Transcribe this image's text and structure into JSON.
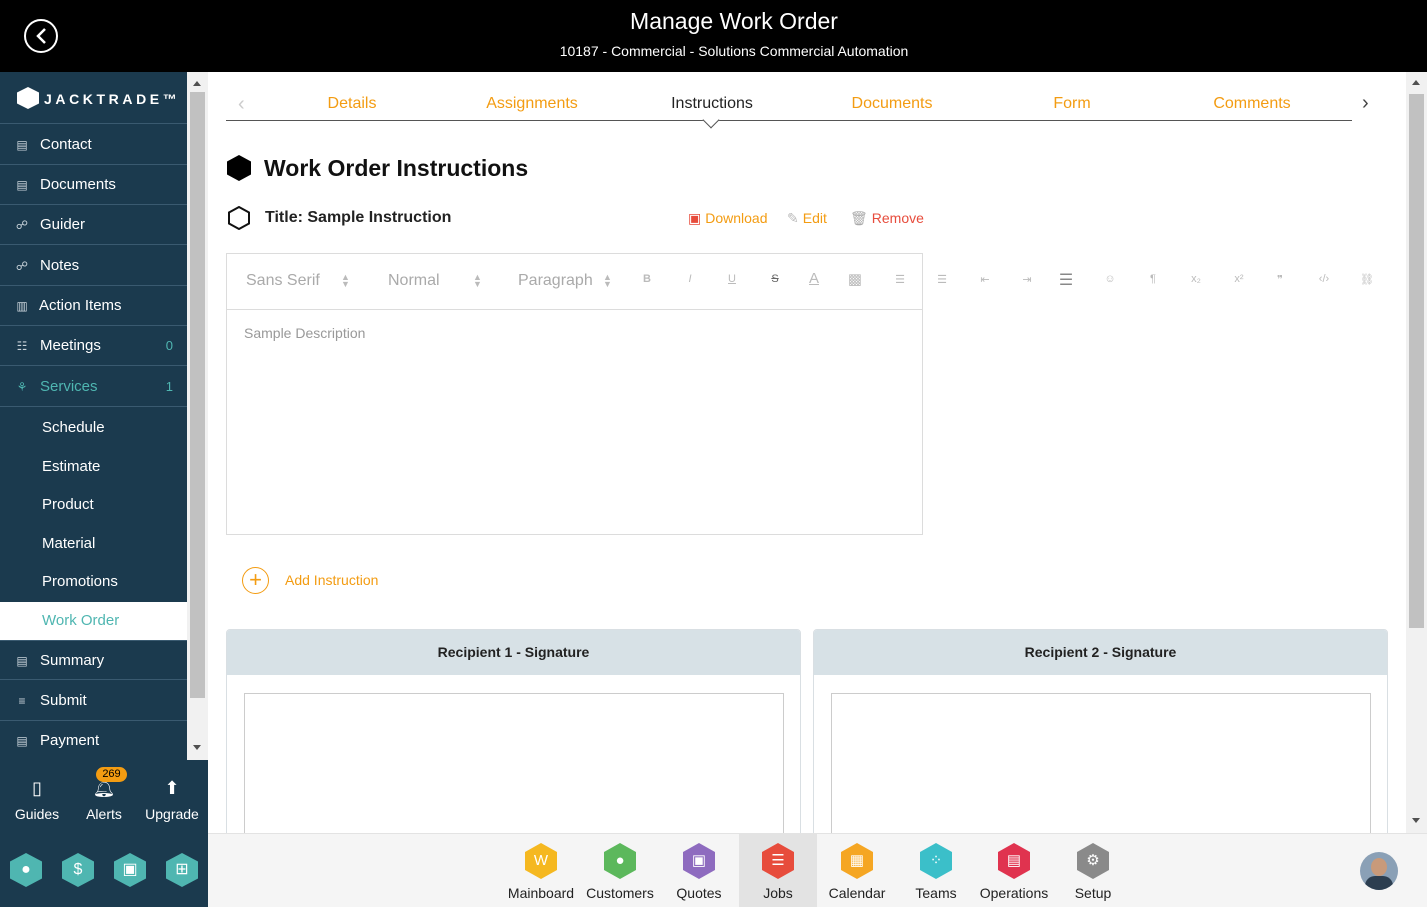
{
  "header": {
    "title": "Manage Work Order",
    "subtitle": "10187 - Commercial - Solutions Commercial Automation"
  },
  "brand": {
    "name": "JACKTRADE™"
  },
  "sidebar": {
    "items": [
      {
        "label": "Contact",
        "icon": "contact-card-icon"
      },
      {
        "label": "Documents",
        "icon": "documents-icon"
      },
      {
        "label": "Guider",
        "icon": "guider-icon"
      },
      {
        "label": "Notes",
        "icon": "notes-icon"
      },
      {
        "label": "Action Items",
        "icon": "clipboard-icon"
      },
      {
        "label": "Meetings",
        "icon": "meetings-icon",
        "count": "0"
      },
      {
        "label": "Services",
        "icon": "services-icon",
        "count": "1"
      }
    ],
    "sub_items": [
      {
        "label": "Schedule"
      },
      {
        "label": "Estimate"
      },
      {
        "label": "Product"
      },
      {
        "label": "Material"
      },
      {
        "label": "Promotions"
      },
      {
        "label": "Work Order"
      }
    ],
    "items_after": [
      {
        "label": "Summary",
        "icon": "summary-icon"
      },
      {
        "label": "Submit",
        "icon": "submit-icon"
      },
      {
        "label": "Payment",
        "icon": "payment-icon"
      }
    ],
    "bottom": {
      "guides": "Guides",
      "alerts": "Alerts",
      "alerts_count": "269",
      "upgrade": "Upgrade"
    }
  },
  "tabs": {
    "items": [
      "Details",
      "Assignments",
      "Instructions",
      "Documents",
      "Form",
      "Comments"
    ],
    "active": "Instructions"
  },
  "section": {
    "title": "Work Order Instructions",
    "instruction_title": "Title: Sample Instruction",
    "download": "Download",
    "edit": "Edit",
    "remove": "Remove"
  },
  "editor": {
    "font": "Sans Serif",
    "size": "Normal",
    "block": "Paragraph",
    "content": "Sample Description"
  },
  "add_instruction": "Add Instruction",
  "signatures": {
    "recipient1": "Recipient 1 - Signature",
    "recipient2": "Recipient 2 - Signature"
  },
  "apps": [
    {
      "label": "Mainboard",
      "color": "#f5b820"
    },
    {
      "label": "Customers",
      "color": "#5cb85c"
    },
    {
      "label": "Quotes",
      "color": "#8e6bbf"
    },
    {
      "label": "Jobs",
      "color": "#e74c3c"
    },
    {
      "label": "Calendar",
      "color": "#f5a623"
    },
    {
      "label": "Teams",
      "color": "#3bbfc9"
    },
    {
      "label": "Operations",
      "color": "#e0334f"
    },
    {
      "label": "Setup",
      "color": "#8a8a8a"
    }
  ],
  "colors": {
    "accent": "#f39c12",
    "teal": "#4fb6b1",
    "sidebar_bg": "#1b3a4e"
  }
}
